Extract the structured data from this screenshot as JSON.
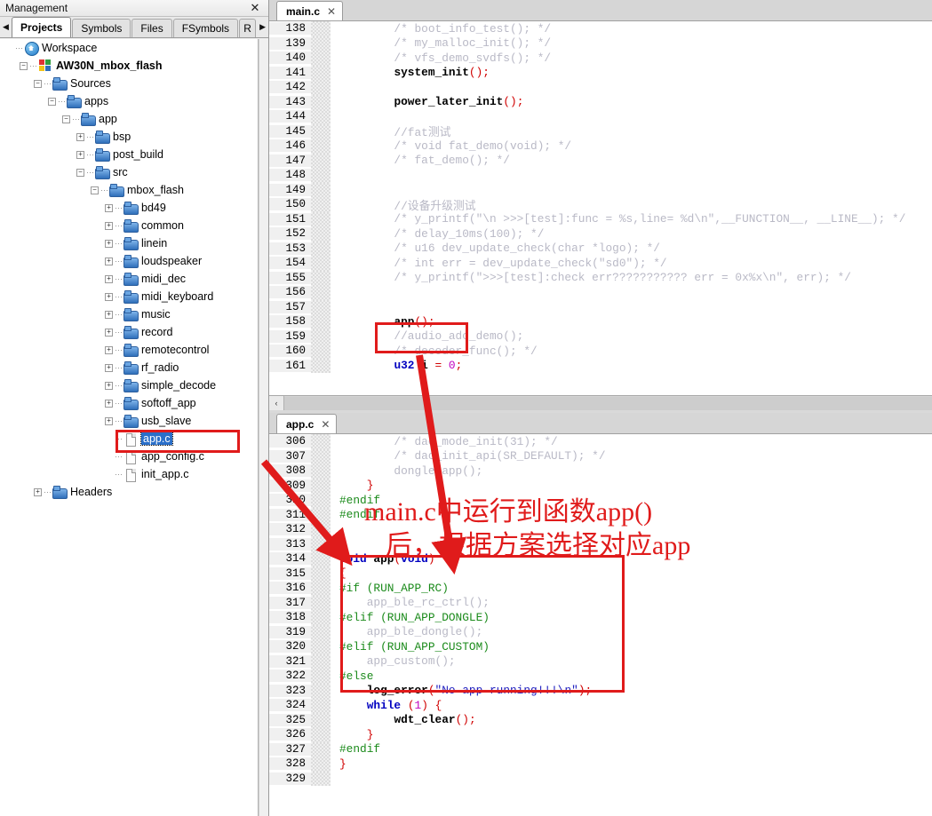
{
  "management": {
    "title": "Management",
    "close_label": "✕",
    "tabs": [
      {
        "label": "Projects",
        "active": true
      },
      {
        "label": "Symbols",
        "active": false
      },
      {
        "label": "Files",
        "active": false
      },
      {
        "label": "FSymbols",
        "active": false
      },
      {
        "label": "R",
        "active": false,
        "clipped": true
      }
    ],
    "nav_left": "◀",
    "nav_right": "▶",
    "tree": [
      {
        "label": "Workspace",
        "depth": 0,
        "icon": "workspace-icon",
        "toggle": "none",
        "bold": false,
        "selected": false
      },
      {
        "label": "AW30N_mbox_flash",
        "depth": 1,
        "icon": "project-icon",
        "toggle": "minus",
        "bold": true,
        "selected": false
      },
      {
        "label": "Sources",
        "depth": 2,
        "icon": "folder-icon",
        "toggle": "minus",
        "bold": false,
        "selected": false
      },
      {
        "label": "apps",
        "depth": 3,
        "icon": "folder-icon",
        "toggle": "minus",
        "bold": false,
        "selected": false
      },
      {
        "label": "app",
        "depth": 4,
        "icon": "folder-icon",
        "toggle": "minus",
        "bold": false,
        "selected": false
      },
      {
        "label": "bsp",
        "depth": 5,
        "icon": "folder-icon",
        "toggle": "plus",
        "bold": false,
        "selected": false
      },
      {
        "label": "post_build",
        "depth": 5,
        "icon": "folder-icon",
        "toggle": "plus",
        "bold": false,
        "selected": false
      },
      {
        "label": "src",
        "depth": 5,
        "icon": "folder-icon",
        "toggle": "minus",
        "bold": false,
        "selected": false
      },
      {
        "label": "mbox_flash",
        "depth": 6,
        "icon": "folder-icon",
        "toggle": "minus",
        "bold": false,
        "selected": false
      },
      {
        "label": "bd49",
        "depth": 7,
        "icon": "folder-icon",
        "toggle": "plus",
        "bold": false,
        "selected": false
      },
      {
        "label": "common",
        "depth": 7,
        "icon": "folder-icon",
        "toggle": "plus",
        "bold": false,
        "selected": false
      },
      {
        "label": "linein",
        "depth": 7,
        "icon": "folder-icon",
        "toggle": "plus",
        "bold": false,
        "selected": false
      },
      {
        "label": "loudspeaker",
        "depth": 7,
        "icon": "folder-icon",
        "toggle": "plus",
        "bold": false,
        "selected": false
      },
      {
        "label": "midi_dec",
        "depth": 7,
        "icon": "folder-icon",
        "toggle": "plus",
        "bold": false,
        "selected": false
      },
      {
        "label": "midi_keyboard",
        "depth": 7,
        "icon": "folder-icon",
        "toggle": "plus",
        "bold": false,
        "selected": false
      },
      {
        "label": "music",
        "depth": 7,
        "icon": "folder-icon",
        "toggle": "plus",
        "bold": false,
        "selected": false
      },
      {
        "label": "record",
        "depth": 7,
        "icon": "folder-icon",
        "toggle": "plus",
        "bold": false,
        "selected": false
      },
      {
        "label": "remotecontrol",
        "depth": 7,
        "icon": "folder-icon",
        "toggle": "plus",
        "bold": false,
        "selected": false
      },
      {
        "label": "rf_radio",
        "depth": 7,
        "icon": "folder-icon",
        "toggle": "plus",
        "bold": false,
        "selected": false
      },
      {
        "label": "simple_decode",
        "depth": 7,
        "icon": "folder-icon",
        "toggle": "plus",
        "bold": false,
        "selected": false
      },
      {
        "label": "softoff_app",
        "depth": 7,
        "icon": "folder-icon",
        "toggle": "plus",
        "bold": false,
        "selected": false
      },
      {
        "label": "usb_slave",
        "depth": 7,
        "icon": "folder-icon",
        "toggle": "plus",
        "bold": false,
        "selected": false
      },
      {
        "label": "app.c",
        "depth": 7,
        "icon": "file-icon",
        "toggle": "none",
        "bold": false,
        "selected": true
      },
      {
        "label": "app_config.c",
        "depth": 7,
        "icon": "file-icon",
        "toggle": "none",
        "bold": false,
        "selected": false
      },
      {
        "label": "init_app.c",
        "depth": 7,
        "icon": "file-icon",
        "toggle": "none",
        "bold": false,
        "selected": false
      },
      {
        "label": "Headers",
        "depth": 2,
        "icon": "folder-icon",
        "toggle": "plus",
        "bold": false,
        "selected": false
      }
    ]
  },
  "editor_main": {
    "tab": {
      "name": "main.c",
      "close": "✕"
    },
    "first_line": 138,
    "scroll_left_btn": "‹",
    "lines": [
      {
        "n": 138,
        "code": "        /* boot_info_test(); */"
      },
      {
        "n": 139,
        "code": "        /* my_malloc_init(); */"
      },
      {
        "n": 140,
        "code": "        /* vfs_demo_svdfs(); */"
      },
      {
        "n": 141,
        "code": "        system_init();"
      },
      {
        "n": 142,
        "code": ""
      },
      {
        "n": 143,
        "code": "        power_later_init();"
      },
      {
        "n": 144,
        "code": ""
      },
      {
        "n": 145,
        "code": "        //fat测试"
      },
      {
        "n": 146,
        "code": "        /* void fat_demo(void); */"
      },
      {
        "n": 147,
        "code": "        /* fat_demo(); */"
      },
      {
        "n": 148,
        "code": ""
      },
      {
        "n": 149,
        "code": ""
      },
      {
        "n": 150,
        "code": "        //设备升级测试"
      },
      {
        "n": 151,
        "code": "        /* y_printf(\"\\n >>>[test]:func = %s,line= %d\\n\",__FUNCTION__, __LINE__); */"
      },
      {
        "n": 152,
        "code": "        /* delay_10ms(100); */"
      },
      {
        "n": 153,
        "code": "        /* u16 dev_update_check(char *logo); */"
      },
      {
        "n": 154,
        "code": "        /* int err = dev_update_check(\"sd0\"); */"
      },
      {
        "n": 155,
        "code": "        /* y_printf(\">>>[test]:check err??????????? err = 0x%x\\n\", err); */"
      },
      {
        "n": 156,
        "code": ""
      },
      {
        "n": 157,
        "code": ""
      },
      {
        "n": 158,
        "code": "        app();"
      },
      {
        "n": 159,
        "code": "        //audio_adc_demo();"
      },
      {
        "n": 160,
        "code": "        /* decoder_func(); */"
      },
      {
        "n": 161,
        "code": "        u32 i = 0;"
      }
    ]
  },
  "editor_app": {
    "tab": {
      "name": "app.c",
      "close": "✕"
    },
    "first_line": 306,
    "lines": [
      {
        "n": 306,
        "code": "        /* dac_mode_init(31); */"
      },
      {
        "n": 307,
        "code": "        /* dac_init_api(SR_DEFAULT); */"
      },
      {
        "n": 308,
        "code": "        dongle_app();"
      },
      {
        "n": 309,
        "code": "    }"
      },
      {
        "n": 310,
        "code": "#endif"
      },
      {
        "n": 311,
        "code": "#endif"
      },
      {
        "n": 312,
        "code": ""
      },
      {
        "n": 313,
        "code": ""
      },
      {
        "n": 314,
        "code": "void app(void)"
      },
      {
        "n": 315,
        "code": "{"
      },
      {
        "n": 316,
        "code": "#if (RUN_APP_RC)"
      },
      {
        "n": 317,
        "code": "    app_ble_rc_ctrl();"
      },
      {
        "n": 318,
        "code": "#elif (RUN_APP_DONGLE)"
      },
      {
        "n": 319,
        "code": "    app_ble_dongle();"
      },
      {
        "n": 320,
        "code": "#elif (RUN_APP_CUSTOM)"
      },
      {
        "n": 321,
        "code": "    app_custom();"
      },
      {
        "n": 322,
        "code": "#else"
      },
      {
        "n": 323,
        "code": "    log_error(\"No app running!!!\\n\");"
      },
      {
        "n": 324,
        "code": "    while (1) {"
      },
      {
        "n": 325,
        "code": "        wdt_clear();"
      },
      {
        "n": 326,
        "code": "    }"
      },
      {
        "n": 327,
        "code": "#endif"
      },
      {
        "n": 328,
        "code": "}"
      },
      {
        "n": 329,
        "code": ""
      }
    ]
  },
  "annotation": {
    "line1": "main.c中运行到函数app()",
    "line2": "后，根据方案选择对应app",
    "color": "#e01b1b",
    "boxes": [
      {
        "name": "app-c-file-highlight-box"
      },
      {
        "name": "app-call-highlight-box"
      },
      {
        "name": "app-function-highlight-box"
      }
    ]
  }
}
